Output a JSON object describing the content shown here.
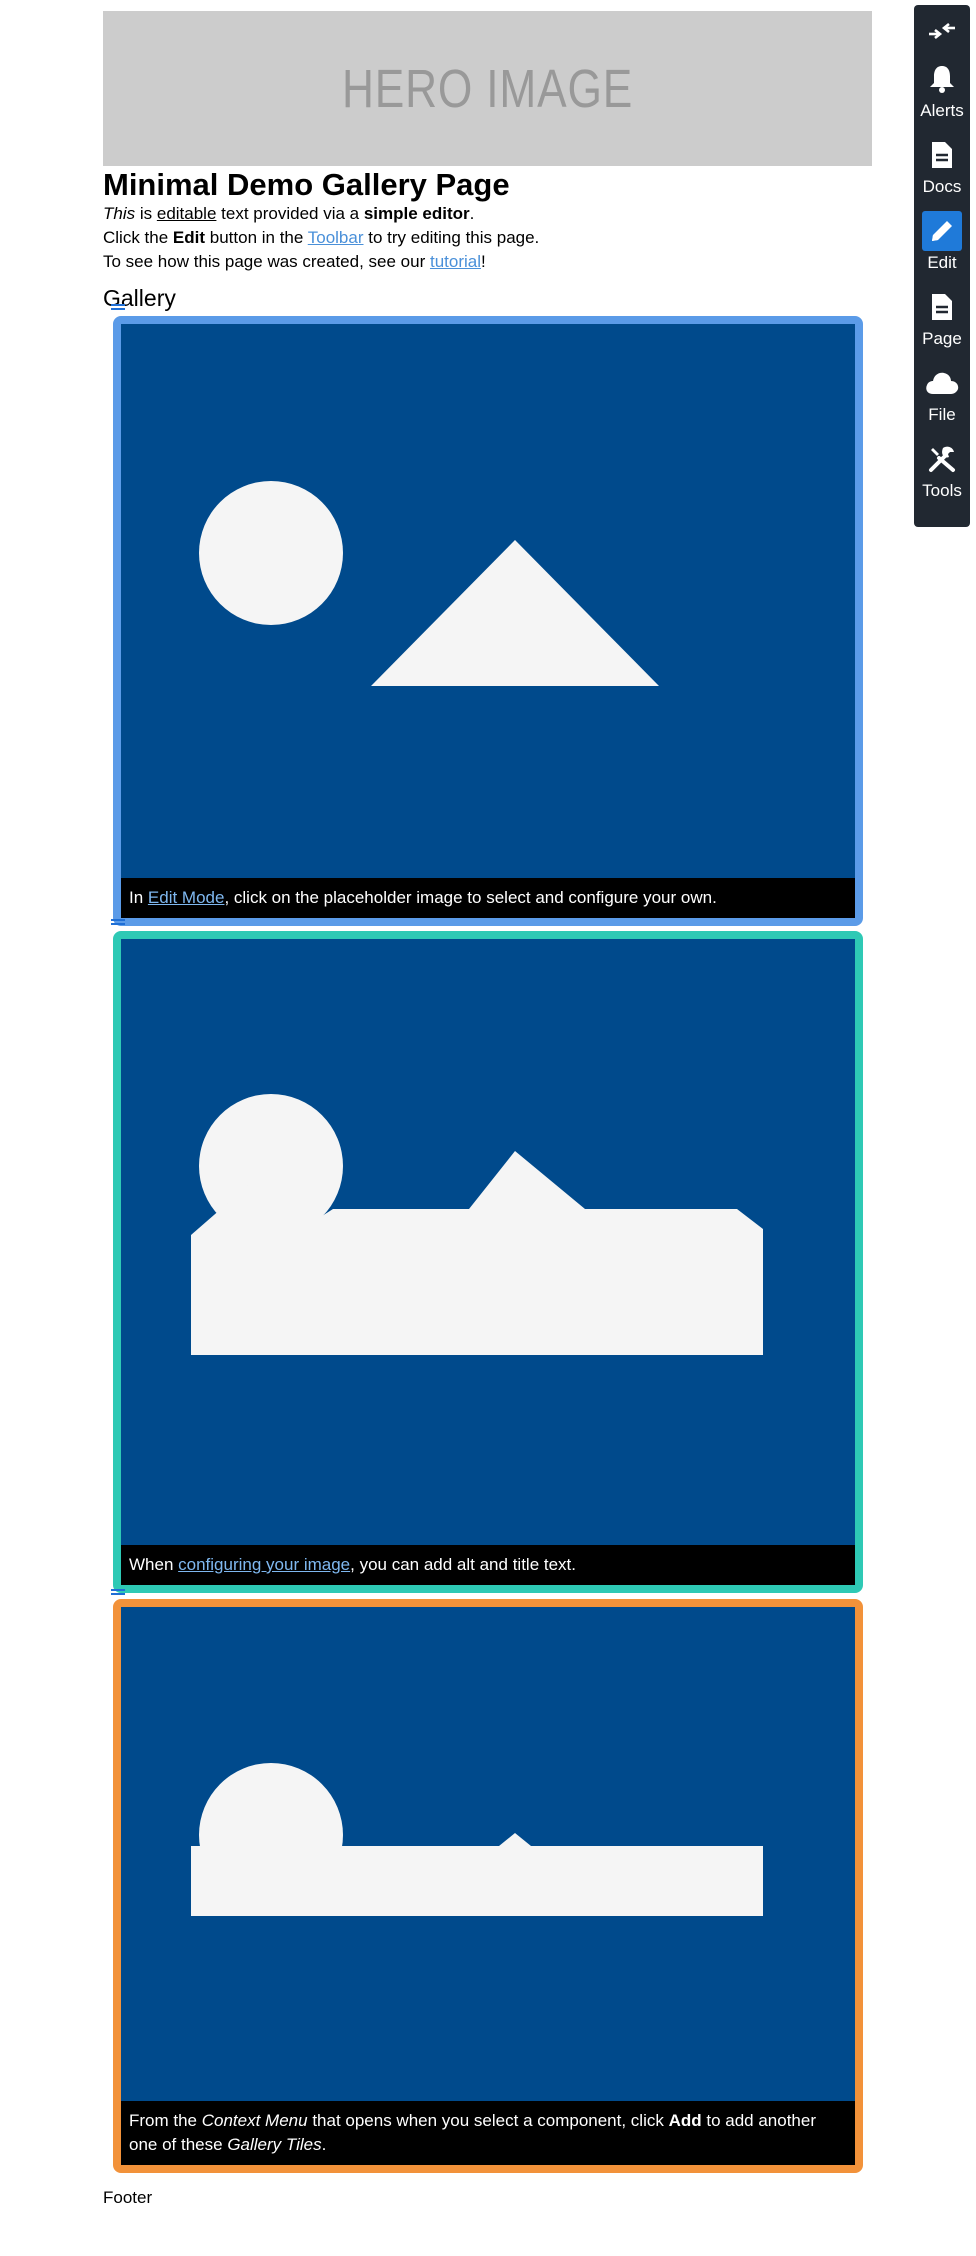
{
  "hero": {
    "text": "HERO IMAGE"
  },
  "page_title": "Minimal Demo Gallery Page",
  "intro": {
    "line1": {
      "italic": "This",
      "t1": " is ",
      "editable": "editable",
      "t2": " text provided via a ",
      "bold": "simple editor",
      "t3": "."
    },
    "line2": {
      "t1": "Click the ",
      "bold": "Edit",
      "t2": " button in the ",
      "link": "Toolbar",
      "t3": " to try editing this page."
    },
    "line3": {
      "t1": "To see how this page was created, see our ",
      "link": "tutorial",
      "t2": "!"
    }
  },
  "gallery_heading": "Gallery",
  "tiles": [
    {
      "caption": {
        "t1": "In ",
        "link": "Edit Mode",
        "t2": ", click on the placeholder image to select and configure your own."
      }
    },
    {
      "caption": {
        "t1": "When ",
        "link": "configuring your image",
        "t2": ", you can add alt and title text."
      }
    },
    {
      "caption": {
        "t1": "From the ",
        "italic1": "Context Menu",
        "t2": " that opens when you select a component, click ",
        "bold": "Add",
        "t3": " to add another one of these ",
        "italic2": "Gallery Tiles",
        "t4": "."
      }
    }
  ],
  "footer": "Footer",
  "toolbar": {
    "items": [
      {
        "label": "",
        "icon": "collapse-icon"
      },
      {
        "label": "Alerts",
        "icon": "bell-icon"
      },
      {
        "label": "Docs",
        "icon": "document-icon"
      },
      {
        "label": "Edit",
        "icon": "pencil-icon",
        "active": true
      },
      {
        "label": "Page",
        "icon": "page-icon"
      },
      {
        "label": "File",
        "icon": "cloud-icon"
      },
      {
        "label": "Tools",
        "icon": "tools-icon"
      }
    ]
  },
  "colors": {
    "tile_bg": "#004a8c",
    "tile1_border": "#5b9be8",
    "tile2_border": "#2ec9b5",
    "tile3_border": "#f2923a",
    "toolbar_bg": "#212831",
    "active_tool": "#1f7ad9"
  }
}
